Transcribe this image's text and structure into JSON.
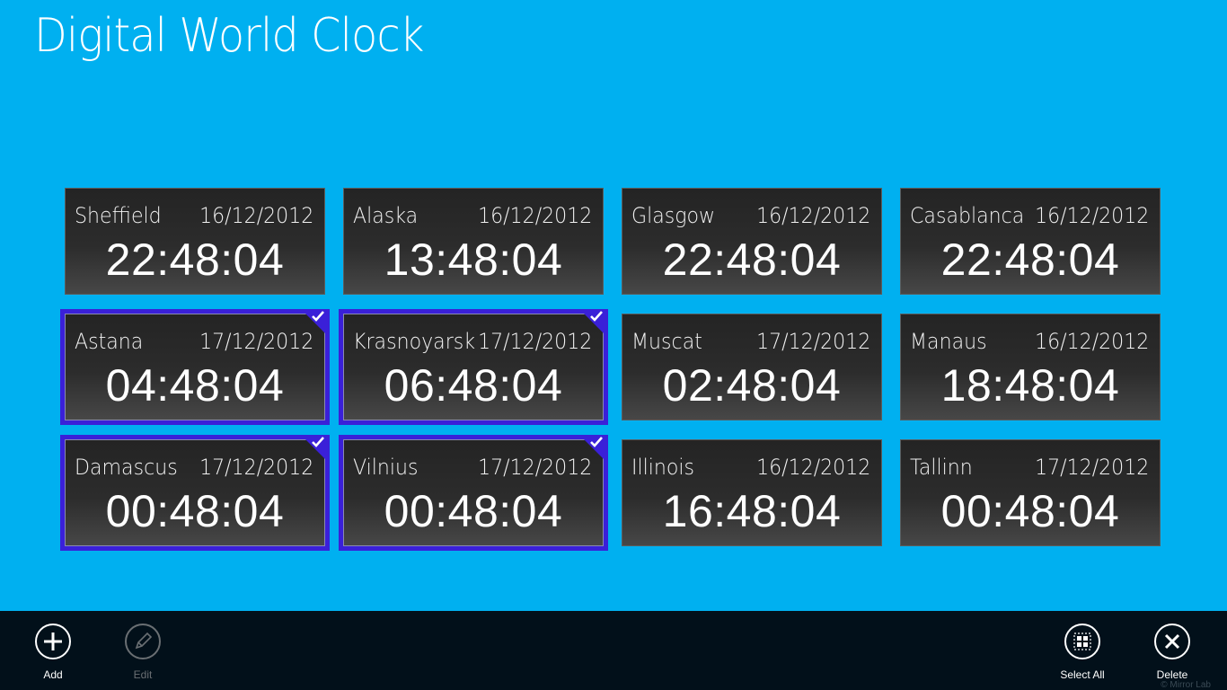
{
  "app": {
    "title": "Digital World Clock"
  },
  "colors": {
    "background": "#00b0f0",
    "selection": "#3a20d8",
    "appbar": "#02101a",
    "tile": "#2a2a2a"
  },
  "clocks": [
    {
      "city": "Sheffield",
      "date": "16/12/2012",
      "time": "22:48:04",
      "selected": false
    },
    {
      "city": "Alaska",
      "date": "16/12/2012",
      "time": "13:48:04",
      "selected": false
    },
    {
      "city": "Glasgow",
      "date": "16/12/2012",
      "time": "22:48:04",
      "selected": false
    },
    {
      "city": "Casablanca",
      "date": "16/12/2012",
      "time": "22:48:04",
      "selected": false
    },
    {
      "city": "Astana",
      "date": "17/12/2012",
      "time": "04:48:04",
      "selected": true
    },
    {
      "city": "Krasnoyarsk",
      "date": "17/12/2012",
      "time": "06:48:04",
      "selected": true
    },
    {
      "city": "Muscat",
      "date": "17/12/2012",
      "time": "02:48:04",
      "selected": false
    },
    {
      "city": "Manaus",
      "date": "16/12/2012",
      "time": "18:48:04",
      "selected": false
    },
    {
      "city": "Damascus",
      "date": "17/12/2012",
      "time": "00:48:04",
      "selected": true
    },
    {
      "city": "Vilnius",
      "date": "17/12/2012",
      "time": "00:48:04",
      "selected": true
    },
    {
      "city": "Illinois",
      "date": "16/12/2012",
      "time": "16:48:04",
      "selected": false
    },
    {
      "city": "Tallinn",
      "date": "17/12/2012",
      "time": "00:48:04",
      "selected": false
    }
  ],
  "appbar": {
    "add": {
      "label": "Add",
      "icon": "plus-icon"
    },
    "edit": {
      "label": "Edit",
      "icon": "pencil-icon",
      "enabled": false
    },
    "select_all": {
      "label": "Select All",
      "icon": "select-all-icon"
    },
    "delete": {
      "label": "Delete",
      "icon": "close-icon"
    },
    "copyright": "© Mirror Lab"
  }
}
